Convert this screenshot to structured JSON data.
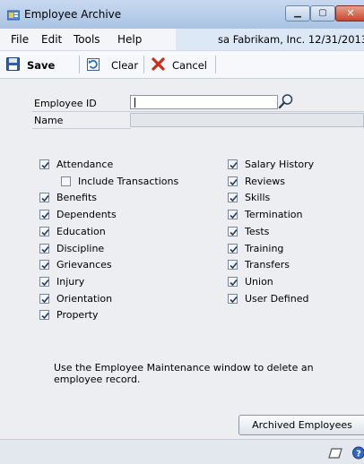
{
  "window": {
    "title": "Employee Archive"
  },
  "menu": {
    "items": [
      "File",
      "Edit",
      "Tools",
      "Help"
    ]
  },
  "company": {
    "text": "sa  Fabrikam, Inc.  12/31/2013"
  },
  "toolbar": {
    "save_label": "Save",
    "clear_label": "Clear",
    "cancel_label": "Cancel"
  },
  "form": {
    "employee_id_label": "Employee ID",
    "employee_id_value": "",
    "name_label": "Name",
    "name_value": ""
  },
  "left_checks": [
    {
      "label": "Attendance",
      "checked": true
    },
    {
      "label": "Include Transactions",
      "checked": false
    },
    {
      "label": "Benefits",
      "checked": true
    },
    {
      "label": "Dependents",
      "checked": true
    },
    {
      "label": "Education",
      "checked": true
    },
    {
      "label": "Discipline",
      "checked": true
    },
    {
      "label": "Grievances",
      "checked": true
    },
    {
      "label": "Injury",
      "checked": true
    },
    {
      "label": "Orientation",
      "checked": true
    },
    {
      "label": "Property",
      "checked": true
    }
  ],
  "right_checks": [
    {
      "label": "Salary History",
      "checked": true
    },
    {
      "label": "Reviews",
      "checked": true
    },
    {
      "label": "Skills",
      "checked": true
    },
    {
      "label": "Termination",
      "checked": true
    },
    {
      "label": "Tests",
      "checked": true
    },
    {
      "label": "Training",
      "checked": true
    },
    {
      "label": "Transfers",
      "checked": true
    },
    {
      "label": "Union",
      "checked": true
    },
    {
      "label": "User Defined",
      "checked": true
    }
  ],
  "note": "Use the Employee Maintenance window to delete an employee record.",
  "archived_button": "Archived Employees",
  "icons": {
    "app": "app-icon",
    "lookup": "lookup-icon",
    "save": "save-icon",
    "clear": "clear-icon",
    "cancel": "cancel-icon",
    "note": "note-icon",
    "help": "help-icon"
  }
}
